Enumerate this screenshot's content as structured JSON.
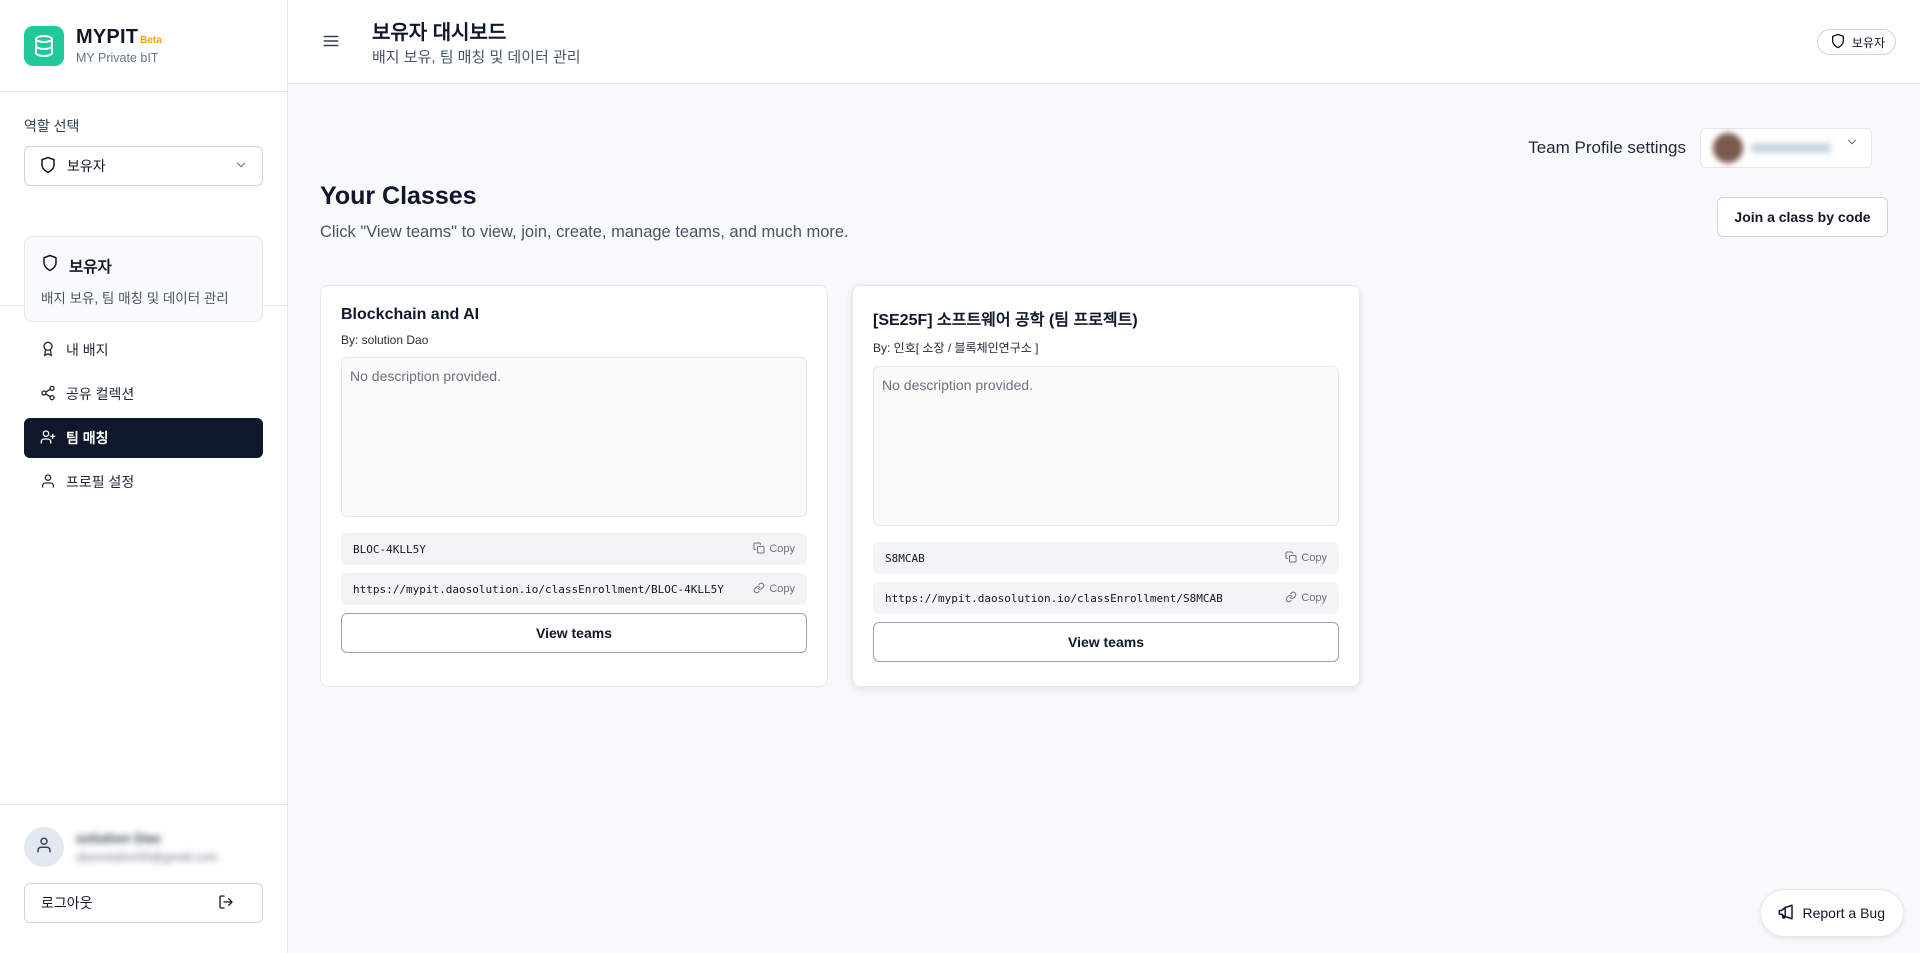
{
  "brand": {
    "name": "MYPIT",
    "badge": "Beta",
    "subtitle": "MY Private bIT"
  },
  "role": {
    "select_label": "역할 선택",
    "selected": "보유자",
    "card_title": "보유자",
    "card_desc": "배지 보유, 팀 매칭 및 데이터 관리"
  },
  "nav": {
    "items": [
      {
        "label": "내 배지",
        "icon": "badge-icon"
      },
      {
        "label": "공유 컬렉션",
        "icon": "share-icon"
      },
      {
        "label": "팀 매칭",
        "icon": "user-plus-icon",
        "active": true
      },
      {
        "label": "프로필 설정",
        "icon": "user-icon"
      }
    ]
  },
  "user": {
    "name": "solution Dao",
    "email": "daosolution00@gmail.com"
  },
  "logout_label": "로그아웃",
  "header": {
    "title": "보유자 대시보드",
    "subtitle": "배지 보유, 팀 매칭 및 데이터 관리",
    "role_badge": "보유자"
  },
  "team_settings": {
    "label": "Team Profile settings",
    "selected": "solution Dao"
  },
  "classes": {
    "title": "Your Classes",
    "subtitle": "Click \"View teams\" to view, join, create, manage teams, and much more.",
    "join_button": "Join a class by code",
    "copy_label": "Copy",
    "view_teams_label": "View teams",
    "items": [
      {
        "title": "Blockchain and AI",
        "by": "By: solution Dao",
        "description": "No description provided.",
        "code": "BLOC-4KLL5Y",
        "link": "https://mypit.daosolution.io/classEnrollment/BLOC-4KLL5Y"
      },
      {
        "title": "[SE25F] 소프트웨어 공학 (팀 프로젝트)",
        "by": "By: 인호[ 소장 / 블록체인연구소 ]",
        "description": "No description provided.",
        "code": "S8MCAB",
        "link": "https://mypit.daosolution.io/classEnrollment/S8MCAB"
      }
    ]
  },
  "report_bug": "Report a Bug",
  "colors": {
    "brand": "#20c997",
    "active_nav": "#0f172a",
    "beta": "#f59e0b"
  }
}
